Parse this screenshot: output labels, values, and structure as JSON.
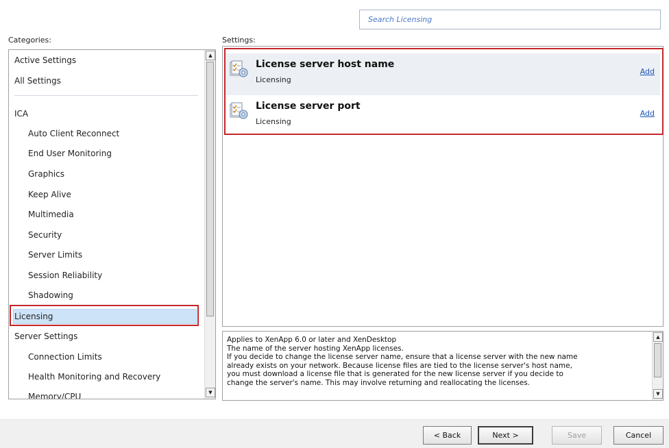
{
  "search": {
    "placeholder": "Search Licensing"
  },
  "categories": {
    "label": "Categories:",
    "items": [
      {
        "label": "Active Settings",
        "level": 0
      },
      {
        "label": "All Settings",
        "level": 0
      },
      {
        "label": "ICA",
        "level": 0
      },
      {
        "label": "Auto Client Reconnect",
        "level": 1
      },
      {
        "label": "End User Monitoring",
        "level": 1
      },
      {
        "label": "Graphics",
        "level": 1
      },
      {
        "label": "Keep Alive",
        "level": 1
      },
      {
        "label": "Multimedia",
        "level": 1
      },
      {
        "label": "Security",
        "level": 1
      },
      {
        "label": "Server Limits",
        "level": 1
      },
      {
        "label": "Session Reliability",
        "level": 1
      },
      {
        "label": "Shadowing",
        "level": 1
      },
      {
        "label": "Licensing",
        "level": 0,
        "selected": true
      },
      {
        "label": "Server Settings",
        "level": 0
      },
      {
        "label": "Connection Limits",
        "level": 1
      },
      {
        "label": "Health Monitoring and Recovery",
        "level": 1
      },
      {
        "label": "Memory/CPU",
        "level": 1
      }
    ]
  },
  "settings": {
    "label": "Settings:",
    "items": [
      {
        "title": "License server host name",
        "category": "Licensing",
        "action": "Add"
      },
      {
        "title": "License server port",
        "category": "Licensing",
        "action": "Add"
      }
    ]
  },
  "description": {
    "lines": [
      "Applies to XenApp 6.0 or later and XenDesktop",
      "The name of the server hosting XenApp licenses.",
      "If you decide to change the license server name, ensure that a license server with the new name",
      "already exists on your network. Because license files are tied to the license server's host name,",
      "you must download a license file that is generated for the new license server if you decide to",
      "change the server's name. This may involve returning and reallocating the licenses."
    ]
  },
  "buttons": {
    "back": "< Back",
    "next": "Next >",
    "save": "Save",
    "cancel": "Cancel"
  },
  "colors": {
    "highlight_border": "#c5252c",
    "selection": "#cde3f8",
    "link": "#1a55b4"
  },
  "icons": {
    "setting_icon": "policy-setting-icon"
  }
}
